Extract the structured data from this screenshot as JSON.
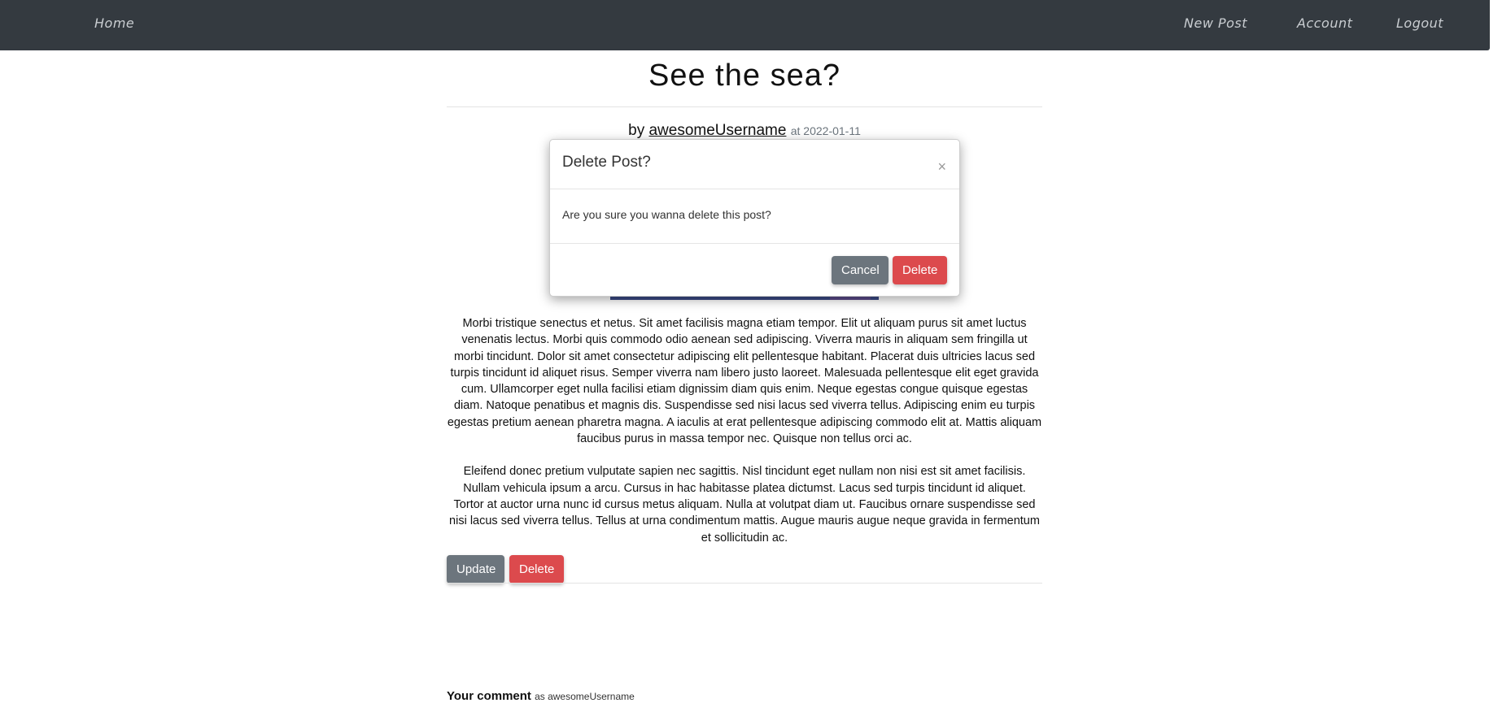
{
  "nav": {
    "home": "Home",
    "new_post": "New Post",
    "account": "Account",
    "logout": "Logout"
  },
  "post": {
    "title": "See the sea?",
    "by": "by",
    "author": "awesomeUsername",
    "at_date": "at 2022-01-11",
    "paragraphs": [
      "Morbi tristique senectus et netus. Sit amet facilisis magna etiam tempor. Elit ut aliquam purus sit amet luctus venenatis lectus. Morbi quis commodo odio aenean sed adipiscing. Viverra mauris in aliquam sem fringilla ut morbi tincidunt. Dolor sit amet consectetur adipiscing elit pellentesque habitant. Placerat duis ultricies lacus sed turpis tincidunt id aliquet risus. Semper viverra nam libero justo laoreet. Malesuada pellentesque elit eget gravida cum. Ullamcorper eget nulla facilisi etiam dignissim diam quis enim. Neque egestas congue quisque egestas diam. Natoque penatibus et magnis dis. Suspendisse sed nisi lacus sed viverra tellus. Adipiscing enim eu turpis egestas pretium aenean pharetra magna. A iaculis at erat pellentesque adipiscing commodo elit at. Mattis aliquam faucibus purus in massa tempor nec. Quisque non tellus orci ac.",
      "Eleifend donec pretium vulputate sapien nec sagittis. Nisl tincidunt eget nullam non nisi est sit amet facilisis. Nullam vehicula ipsum a arcu. Cursus in hac habitasse platea dictumst. Lacus sed turpis tincidunt id aliquet. Tortor at auctor urna nunc id cursus metus aliquam. Nulla at volutpat diam ut. Faucibus ornare suspendisse sed nisi lacus sed viverra tellus. Tellus at urna condimentum mattis. Augue mauris augue neque gravida in fermentum et sollicitudin ac."
    ],
    "update_label": "Update",
    "delete_label": "Delete"
  },
  "comment": {
    "label": "Your comment",
    "as_user": "as awesomeUsername"
  },
  "modal": {
    "title": "Delete Post?",
    "close_glyph": "×",
    "message": "Are you sure you wanna delete this post?",
    "cancel_label": "Cancel",
    "delete_label": "Delete"
  },
  "colors": {
    "navbar": "#343a40",
    "secondary": "#6c757d",
    "danger": "#dc4a4d"
  }
}
